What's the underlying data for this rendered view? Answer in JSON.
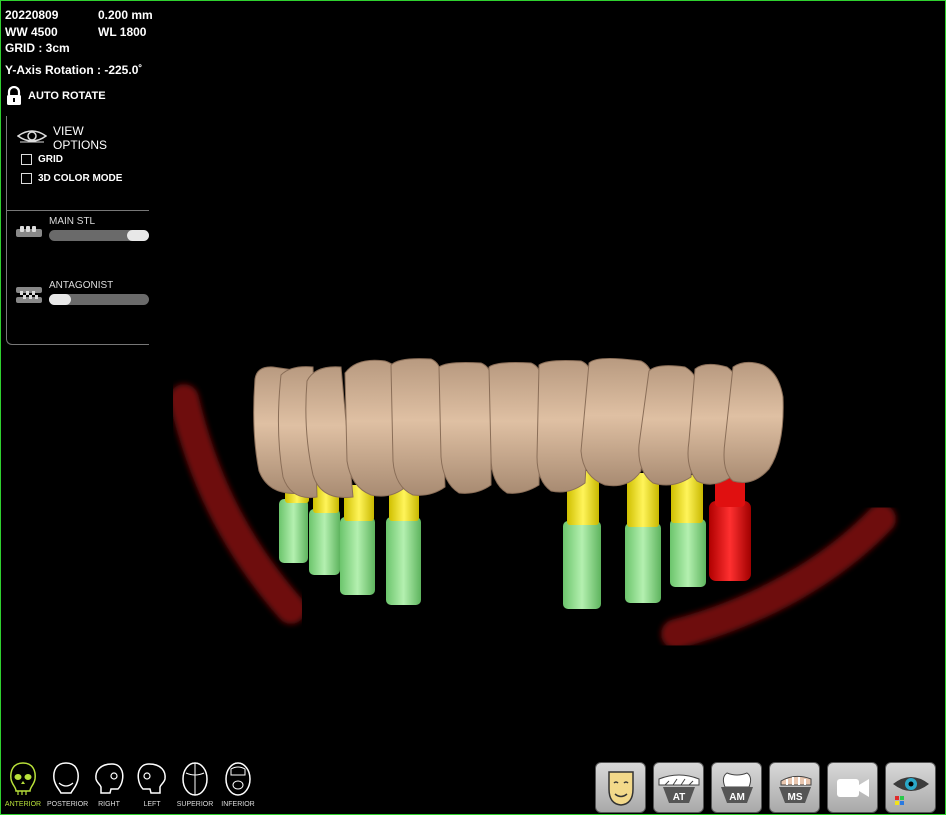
{
  "info": {
    "date": "20220809",
    "slice_thickness": "0.200 mm",
    "window_width": "WW 4500",
    "window_level": "WL 1800",
    "grid": "GRID : 3cm",
    "rotation": "Y-Axis Rotation : -225.0˚"
  },
  "auto_rotate": {
    "label": "AUTO ROTATE",
    "icon": "lock-icon"
  },
  "view_options": {
    "title_line1": "VIEW",
    "title_line2": "OPTIONS",
    "icon": "eye-icon",
    "grid_label": "GRID",
    "grid_checked": false,
    "color_mode_label": "3D COLOR MODE",
    "color_mode_checked": false
  },
  "main_stl": {
    "label": "MAIN STL",
    "opacity": 1.0,
    "icon": "lower-jaw-icon"
  },
  "antagonist": {
    "label": "ANTAGONIST",
    "opacity": 0.0,
    "icon": "bite-icon"
  },
  "views": [
    {
      "label": "ANTERIOR",
      "icon": "skull-front-icon",
      "active": true
    },
    {
      "label": "POSTERIOR",
      "icon": "skull-back-icon",
      "active": false
    },
    {
      "label": "RIGHT",
      "icon": "skull-right-icon",
      "active": false
    },
    {
      "label": "LEFT",
      "icon": "skull-left-icon",
      "active": false
    },
    {
      "label": "SUPERIOR",
      "icon": "skull-top-icon",
      "active": false
    },
    {
      "label": "INFERIOR",
      "icon": "skull-bottom-icon",
      "active": false
    }
  ],
  "toolbar": {
    "face_icon": "face-icon",
    "at_label": "AT",
    "am_label": "AM",
    "ms_label": "MS",
    "camera_icon": "camera-icon",
    "visibility_icon": "eye-visibility-icon"
  },
  "colors": {
    "border": "#2fd12f",
    "tooth": "#d9b89b",
    "abutment": "#f2e21a",
    "implant": "#8fe08f",
    "implant_alert": "#e01010",
    "nerve": "#7a0a0a",
    "active_view": "#b9e13a"
  }
}
